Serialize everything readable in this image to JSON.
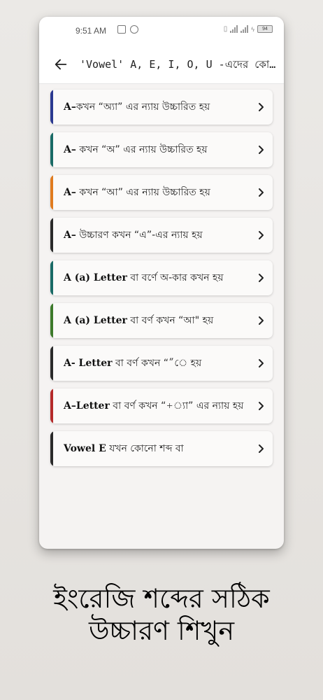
{
  "status": {
    "time": "9:51 AM",
    "battery": "94"
  },
  "header": {
    "title": "'Vowel' A, E, I, O, U -এদের কোথায় কি ..."
  },
  "items": [
    {
      "bold": "A–",
      "text": "কখন “অ্যা” এর ন্যায় উচ্চারিত হয়",
      "color": "#2b3990"
    },
    {
      "bold": "A–",
      "text": " কখন “অ” এর ন্যায় উচ্চারিত হয়",
      "color": "#1a6b66"
    },
    {
      "bold": "A–",
      "text": " কখন “আ” এর ন্যায় উচ্চারিত হয়",
      "color": "#e07b1f"
    },
    {
      "bold": "A–",
      "text": " উচ্চারণ কখন “এ”-এর ন্যায় হয়",
      "color": "#2a2a2a"
    },
    {
      "bold": "A (a) Letter",
      "text": " বা বর্ণে অ-কার কখন হয়",
      "color": "#1a6b66"
    },
    {
      "bold": "A (a) Letter",
      "text": " বা বর্ণ কখন “আ\" হয়",
      "color": "#3d7a2b"
    },
    {
      "bold": "A- Letter",
      "text": " বা বর্ণ কখন “”ে হয়",
      "color": "#2a2a2a"
    },
    {
      "bold": "A–Letter",
      "text": " বা বর্ণ কখন “+্যা” এর ন্যায় হয়",
      "color": "#b52a2a"
    },
    {
      "bold": "Vowel E",
      "text": " যখন কোনো শব্দ বা",
      "color": "#2a2a2a"
    }
  ],
  "caption": {
    "line1": "ইংরেজি শব্দের সঠিক",
    "line2": "উচ্চারণ শিখুন"
  }
}
